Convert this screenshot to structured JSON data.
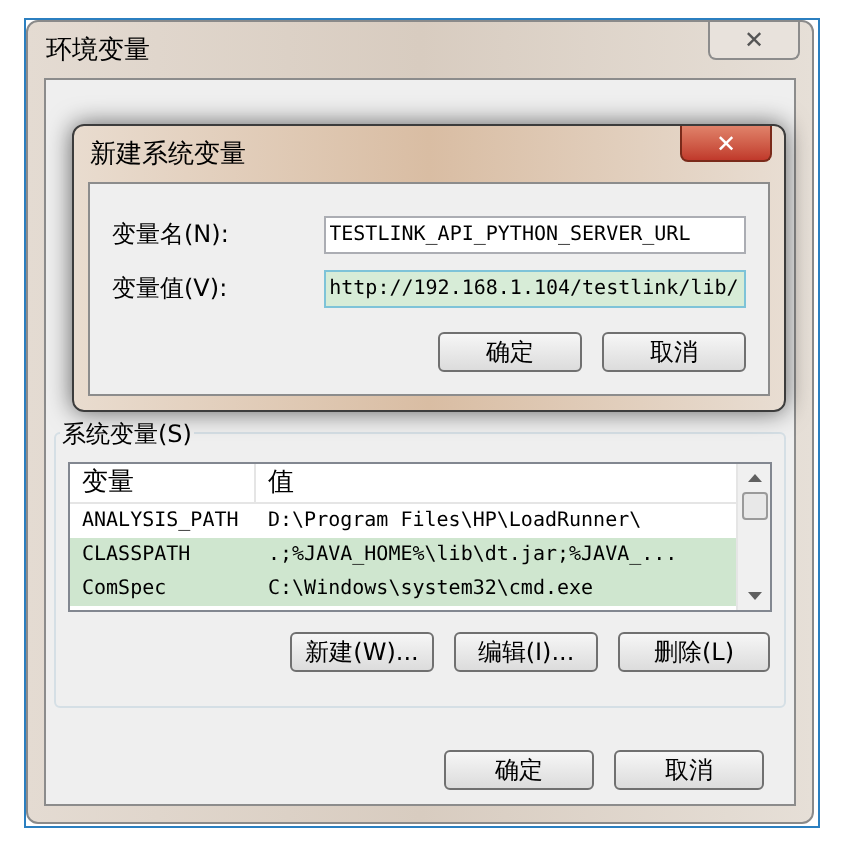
{
  "window": {
    "title": "环境变量",
    "close": "✕"
  },
  "dialog": {
    "title": "新建系统变量",
    "close": "✕",
    "fields": [
      {
        "label": "变量名(N):",
        "value": "TESTLINK_API_PYTHON_SERVER_URL",
        "focused": false
      },
      {
        "label": "变量值(V):",
        "value": "http://192.168.1.104/testlink/lib/",
        "focused": true
      }
    ],
    "buttons": [
      "确定",
      "取消"
    ]
  },
  "system_variables": {
    "title": "系统变量(S)",
    "columns": [
      "变量",
      "值"
    ],
    "rows": [
      {
        "name": "ANALYSIS_PATH",
        "value": "D:\\Program Files\\HP\\LoadRunner\\",
        "highlighted": false
      },
      {
        "name": "CLASSPATH",
        "value": ".;%JAVA_HOME%\\lib\\dt.jar;%JAVA_...",
        "highlighted": true
      },
      {
        "name": "ComSpec",
        "value": "C:\\Windows\\system32\\cmd.exe",
        "highlighted": true
      }
    ],
    "buttons": [
      "新建(W)...",
      "编辑(I)...",
      "删除(L)"
    ]
  },
  "buttons": [
    "确定",
    "取消"
  ]
}
